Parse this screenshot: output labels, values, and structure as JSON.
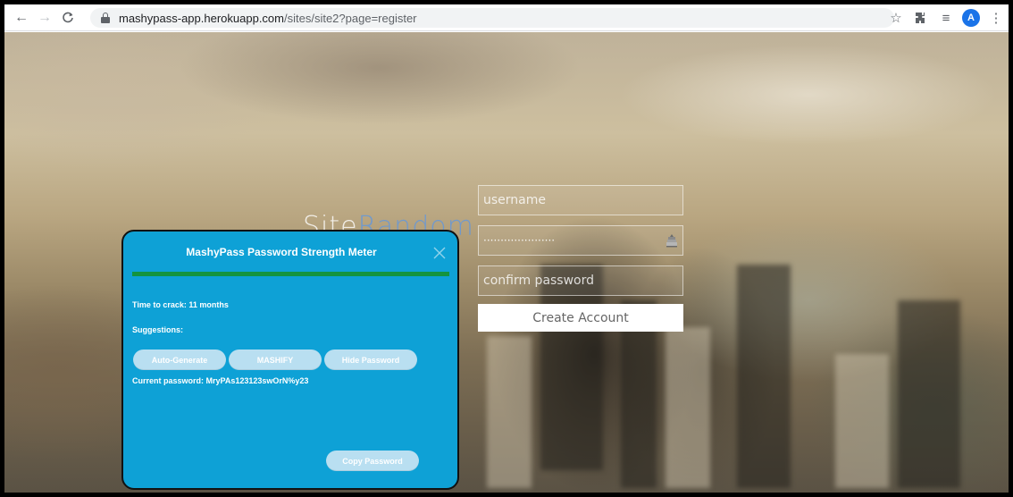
{
  "browser": {
    "url_host": "mashypass-app.herokuapp.com",
    "url_path": "/sites/site2?page=register",
    "back_icon": "←",
    "forward_icon": "→",
    "reload_icon": "C",
    "star_icon": "☆",
    "extensions_icon": "✱",
    "reading_list_icon": "≡",
    "profile_initial": "A",
    "menu_icon": "⋮"
  },
  "site": {
    "title_prefix": "Site",
    "title_suffix": "Random"
  },
  "form": {
    "username_placeholder": "username",
    "password_value": "·····················",
    "confirm_placeholder": "confirm password",
    "create_label": "Create Account"
  },
  "meter_popup": {
    "title": "MashyPass Password Strength Meter",
    "strength_fraction": 1.0,
    "strength_color": "#14933f",
    "time_to_crack": "Time to crack: 11 months",
    "suggestions_label": "Suggestions:",
    "auto_generate_label": "Auto-Generate",
    "mashify_label": "MASHIFY",
    "hide_password_label": "Hide Password",
    "current_password": "Current password: MryPAs123123swOrN%y23",
    "copy_password_label": "Copy Password",
    "close_icon": "close-icon"
  },
  "colors": {
    "popup_bg": "#0ea1d6",
    "button_bg": "#b9dff1",
    "profile_bg": "#1a73e8"
  }
}
